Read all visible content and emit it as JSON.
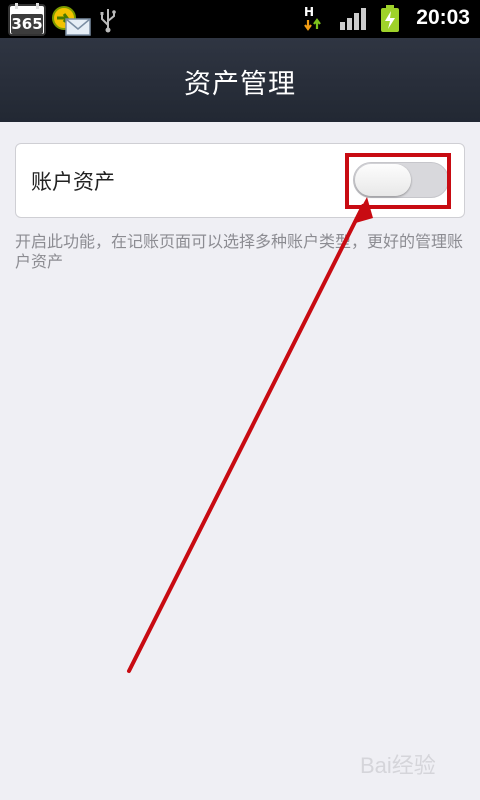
{
  "status_bar": {
    "calendar_badge": "365",
    "network_label": "H",
    "time": "20:03"
  },
  "header": {
    "title": "资产管理"
  },
  "settings": {
    "row_label": "账户资产",
    "toggle_state": "off",
    "description": "开启此功能，在记账页面可以选择多种账户类型，更好的管理账户资产"
  },
  "icons": {
    "calendar": "calendar-icon",
    "mail": "mail-icon",
    "usb": "usb-icon",
    "network": "hspa-network-icon",
    "signal": "signal-icon",
    "battery": "battery-charging-icon"
  },
  "colors": {
    "header_bg": "#2a303c",
    "page_bg": "#efeff4",
    "highlight": "#c80b12"
  },
  "watermark": {
    "text": "Bai经验"
  }
}
